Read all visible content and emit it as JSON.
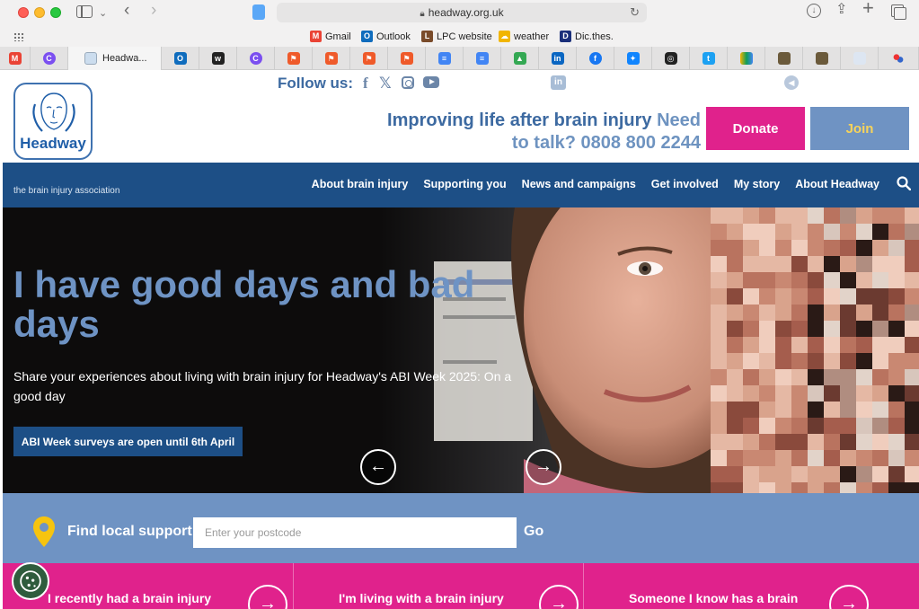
{
  "browser": {
    "url": "headway.org.uk",
    "bookmarks": [
      {
        "label": "Gmail",
        "icon": "gmail-icon",
        "color": "#ea4335",
        "glyph": "M"
      },
      {
        "label": "Outlook",
        "icon": "outlook-icon",
        "color": "#0f6cbd",
        "glyph": "O"
      },
      {
        "label": "LPC website",
        "icon": "lpc-icon",
        "color": "#7a4b2a",
        "glyph": "L"
      },
      {
        "label": "weather",
        "icon": "weather-icon",
        "color": "#f1b500",
        "glyph": "☁"
      },
      {
        "label": "Dic.thes.",
        "icon": "dictionary-icon",
        "color": "#1a2f7a",
        "glyph": "D"
      }
    ],
    "active_tab_label": "Headwa..."
  },
  "follow": {
    "label": "Follow us:"
  },
  "header": {
    "logo_word": "Headway",
    "logo_subtitle": "the brain injury association",
    "tagline_main": "Improving life after brain injury",
    "tagline_need": "Need",
    "tagline_phone": "to talk? 0808 800 2244",
    "donate_label": "Donate",
    "join_label": "Join"
  },
  "nav": {
    "items": [
      "About brain injury",
      "Supporting you",
      "News and campaigns",
      "Get involved",
      "My story",
      "About Headway"
    ]
  },
  "hero": {
    "title": "I have good days and bad days",
    "text": "Share your experiences about living with brain injury for Headway's ABI Week 2025: On a good day",
    "cta_label": "ABI Week surveys are open until 6th April",
    "prev_glyph": "←",
    "next_glyph": "→"
  },
  "local_support": {
    "label": "Find local support",
    "placeholder": "Enter your postcode",
    "go_label": "Go"
  },
  "pathways": [
    {
      "label": "I recently had a brain injury"
    },
    {
      "label": "I'm living with a brain injury"
    },
    {
      "label": "Someone I know has a brain"
    }
  ],
  "colors": {
    "navy": "#1d4f86",
    "light_blue": "#6f93c3",
    "pink": "#e0228c",
    "join_text": "#f7d35a"
  }
}
